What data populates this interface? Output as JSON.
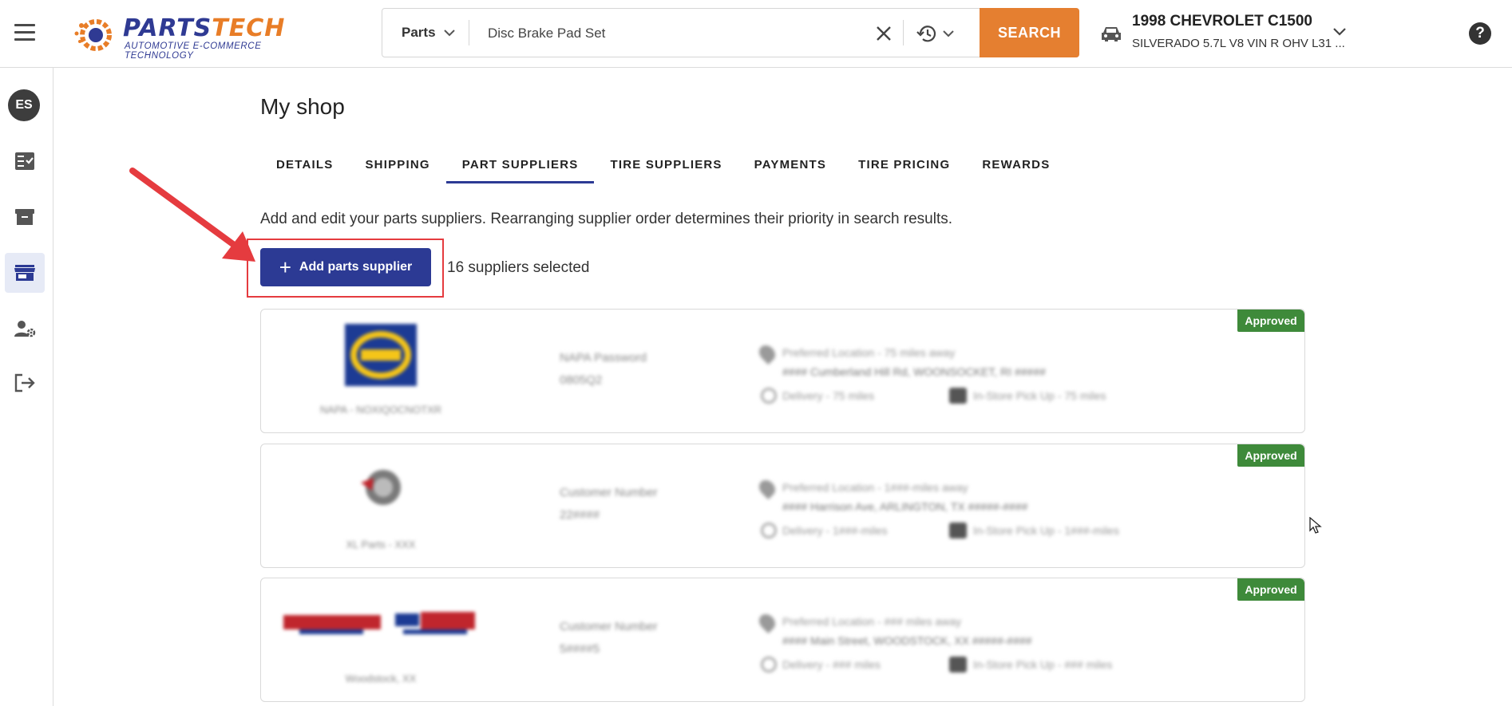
{
  "header": {
    "logo_text_a": "PARTS",
    "logo_text_b": "TECH",
    "logo_tagline": "AUTOMOTIVE E-COMMERCE TECHNOLOGY",
    "search_type": "Parts",
    "search_value": "Disc Brake Pad Set",
    "search_button": "SEARCH",
    "vehicle_title": "1998 CHEVROLET C1500",
    "vehicle_sub": "SILVERADO 5.7L V8 VIN R OHV L31 ...",
    "help": "?"
  },
  "sidebar": {
    "avatar_initials": "ES",
    "items": [
      {
        "icon": "checklist-icon"
      },
      {
        "icon": "archive-icon"
      },
      {
        "icon": "store-icon",
        "active": true
      },
      {
        "icon": "user-settings-icon"
      },
      {
        "icon": "logout-icon"
      }
    ]
  },
  "main": {
    "title": "My shop",
    "tabs": [
      "DETAILS",
      "SHIPPING",
      "PART SUPPLIERS",
      "TIRE SUPPLIERS",
      "PAYMENTS",
      "TIRE PRICING",
      "REWARDS"
    ],
    "active_tab": "PART SUPPLIERS",
    "description": "Add and edit your parts suppliers. Rearranging supplier order determines their priority in search results.",
    "add_button": "Add parts supplier",
    "selected_count": "16 suppliers selected"
  },
  "suppliers": [
    {
      "status": "Approved",
      "name": "NAPA - NOXIQOCNOTXR",
      "account_label": "NAPA Password",
      "account_value": "0805Q2",
      "location_line1": "Preferred Location - 75 miles away",
      "location_line2": "#### Cumberland Hill Rd, WOONSOCKET, RI #####",
      "delivery": "Delivery - 75 miles",
      "pickup": "In-Store Pick Up - 75 miles"
    },
    {
      "status": "Approved",
      "name": "XL Parts - XXX",
      "account_label": "Customer Number",
      "account_value": "22####",
      "location_line1": "Preferred Location - 1###-miles away",
      "location_line2": "#### Harrison Ave, ARLINGTON, TX #####-####",
      "delivery": "Delivery - 1###-miles",
      "pickup": "In-Store Pick Up - 1###-miles"
    },
    {
      "status": "Approved",
      "name": "Woodstock, XX",
      "account_label": "Customer Number",
      "account_value": "5####5",
      "location_line1": "Preferred Location - ### miles away",
      "location_line2": "#### Main Street, WOODSTOCK, XX #####-####",
      "delivery": "Delivery - ### miles",
      "pickup": "In-Store Pick Up - ### miles"
    }
  ],
  "colors": {
    "brand_blue": "#2c3a94",
    "brand_orange": "#e57f30",
    "approved_green": "#3e8a3a",
    "annotation_red": "#e53b3f"
  }
}
